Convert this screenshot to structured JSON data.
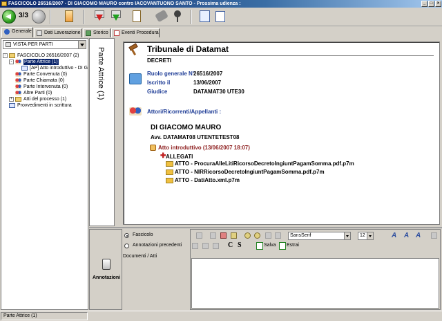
{
  "window": {
    "title": "FASCICOLO 26516/2007 - DI GIACOMO MAURO contro IACOVANTUONO SANTO - Prossima udienza :"
  },
  "toolbar": {
    "nav_count": "3/3"
  },
  "tabs": [
    {
      "label": "Generale",
      "active": true
    },
    {
      "label": "Dati Lavorazione",
      "active": false
    },
    {
      "label": "Storico",
      "active": false
    },
    {
      "label": "Eventi Procedura",
      "active": false
    }
  ],
  "left_panel": {
    "view_select": "VISTA PER PARTI",
    "tree": [
      {
        "label": "FASCICOLO 26516/2007 (2)",
        "icon": "folder-icon",
        "level": 0,
        "expander": "-"
      },
      {
        "label": "Parte Attrice (1)",
        "icon": "people-icon",
        "level": 1,
        "expander": "-",
        "selected": true
      },
      {
        "label": "[AP] Atto introduttivo - DI G",
        "icon": "file-icon",
        "level": 2,
        "expander": ""
      },
      {
        "label": "Parte Convenuta (0)",
        "icon": "people-icon",
        "level": 1,
        "expander": ""
      },
      {
        "label": "Parte Chiamata (0)",
        "icon": "people-icon",
        "level": 1,
        "expander": ""
      },
      {
        "label": "Parte Intervenuta (0)",
        "icon": "people-icon",
        "level": 1,
        "expander": ""
      },
      {
        "label": "Altre Parti (0)",
        "icon": "people-icon",
        "level": 1,
        "expander": ""
      },
      {
        "label": "Atti del processo (1)",
        "icon": "folder-icon",
        "level": 1,
        "expander": "+"
      },
      {
        "label": "Provvedimenti in scrittura",
        "icon": "file-icon",
        "level": 0,
        "expander": ""
      }
    ]
  },
  "vertical_label": "Parte Attrice (1)",
  "content": {
    "court": "Tribunale di Datamat",
    "section": "DECRETI",
    "meta": [
      {
        "label": "Ruolo generale N°",
        "value": "26516/2007"
      },
      {
        "label": "Iscritto il",
        "value": "13/06/2007"
      },
      {
        "label": "Giudice",
        "value": "DATAMAT30 UTE30"
      }
    ],
    "parties_heading": "Attori/Ricorrenti/Appellanti :",
    "party_name": "DI GIACOMO MAURO",
    "lawyer": "Avv. DATAMAT08 UTENTETEST08",
    "atto": "Atto introduttivo (13/06/2007 18:07)",
    "allegati_label": "ALLEGATI",
    "attachments": [
      "ATTO - ProcuraAlleLitiRicorsoDecretoIngiuntPagamSomma.pdf.p7m",
      "ATTO - NIRRicorsoDecretoIngiuntPagamSomma.pdf.p7m",
      "ATTO - DatiAtto.xml.p7m"
    ]
  },
  "bottom": {
    "annot_label": "Annotazioni",
    "radio_fascicolo": "Fascicolo",
    "radio_prec": "Annotazioni precedenti",
    "docs_label": "Documenti / Atti",
    "font": "SansSerif",
    "size": "12",
    "c_label": "C",
    "s_label": "S",
    "salva": "Salva",
    "estrai": "Estrai"
  },
  "status": {
    "text": "Parte Attrice (1)"
  },
  "colors": {
    "accent": "#1e3c96",
    "atto": "#8c1c1c",
    "selection": "#0a246a"
  }
}
